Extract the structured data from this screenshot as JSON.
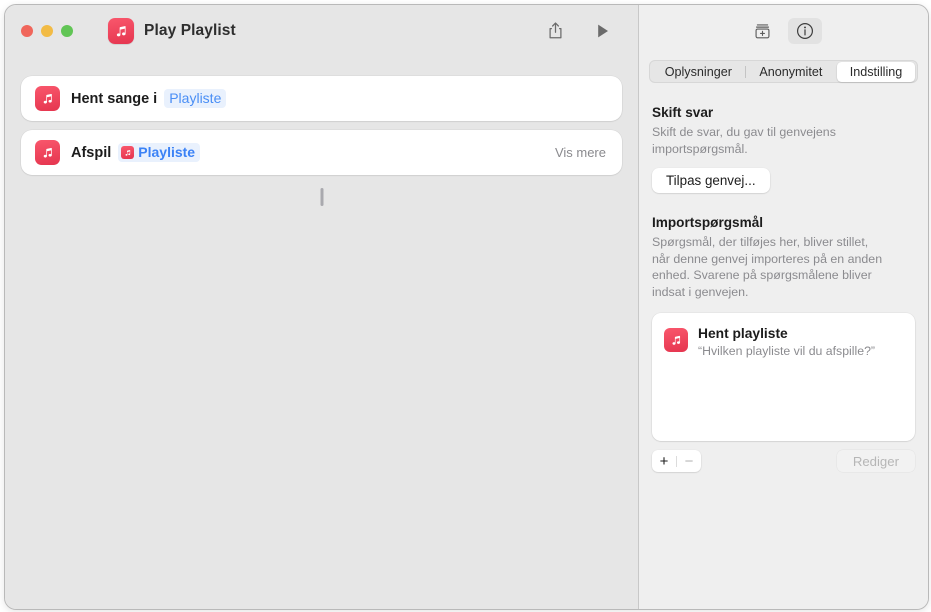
{
  "window": {
    "title": "Play Playlist",
    "app_icon": "music-note-icon",
    "traffic_lights": [
      "close-button",
      "minimize-button",
      "zoom-button"
    ],
    "toolbar": {
      "share_label": "share-icon",
      "play_label": "play-icon"
    }
  },
  "editor": {
    "connector": "action-connector",
    "actions": [
      {
        "icon": "music-note-icon",
        "prefix": "Hent sange i",
        "token": "Playliste",
        "token_has_icon": false,
        "token_bold": false,
        "trailing": ""
      },
      {
        "icon": "music-note-icon",
        "prefix": "Afspil",
        "token": "Playliste",
        "token_has_icon": true,
        "token_bold": true,
        "trailing": "Vis mere"
      }
    ]
  },
  "inspector": {
    "toolbar": {
      "add_shortcut_icon": "add-to-library-icon",
      "info_icon": "info-circle-icon"
    },
    "tabs": [
      {
        "label": "Oplysninger",
        "active": false
      },
      {
        "label": "Anonymitet",
        "active": false
      },
      {
        "label": "Indstilling",
        "active": true
      }
    ],
    "change_answers": {
      "title": "Skift svar",
      "description": "Skift de svar, du gav til genvejens importspørgsmål.",
      "button_label": "Tilpas genvej..."
    },
    "import_questions": {
      "title": "Importspørgsmål",
      "description": "Spørgsmål, der tilføjes her, bliver stillet, når denne genvej importeres på en anden enhed. Svarene på spørgsmålene bliver indsat i genvejen.",
      "items": [
        {
          "icon": "music-note-icon",
          "title": "Hent playliste",
          "subtitle": "“Hvilken playliste vil du afspille?”"
        }
      ],
      "footer": {
        "add_label": "+",
        "remove_label": "−",
        "edit_label": "Rediger"
      }
    }
  },
  "colors": {
    "accent_red": "#e5354f",
    "token_blue": "#4a8ef5",
    "window_bg": "#e6e6e6",
    "inspector_bg": "#efefef"
  }
}
